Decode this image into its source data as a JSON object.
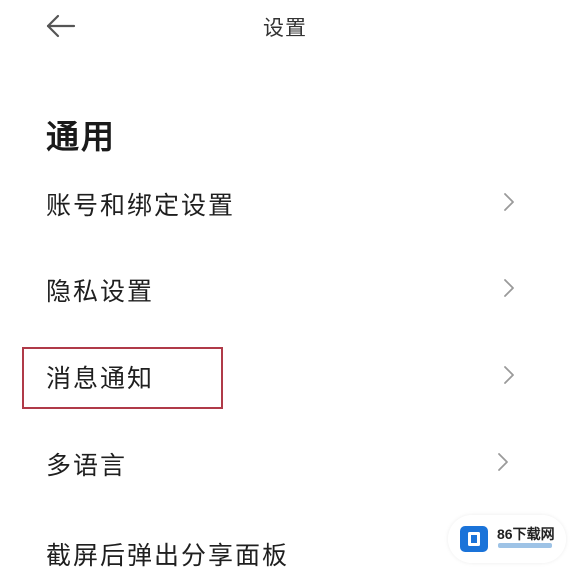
{
  "header": {
    "back_icon": "arrow-left-icon",
    "title": "设置"
  },
  "section": {
    "title": "通用"
  },
  "menu": {
    "items": [
      {
        "label": "账号和绑定设置",
        "icon": "chevron-right-icon"
      },
      {
        "label": "隐私设置",
        "icon": "chevron-right-icon"
      },
      {
        "label": "消息通知",
        "icon": "chevron-right-icon",
        "highlighted": true
      },
      {
        "label": "多语言",
        "icon": "chevron-right-icon"
      },
      {
        "label": "截屏后弹出分享面板"
      }
    ]
  },
  "highlight_color": "#b03a48",
  "watermark": {
    "text": "86下载网",
    "logo_color": "#1a73d9"
  }
}
